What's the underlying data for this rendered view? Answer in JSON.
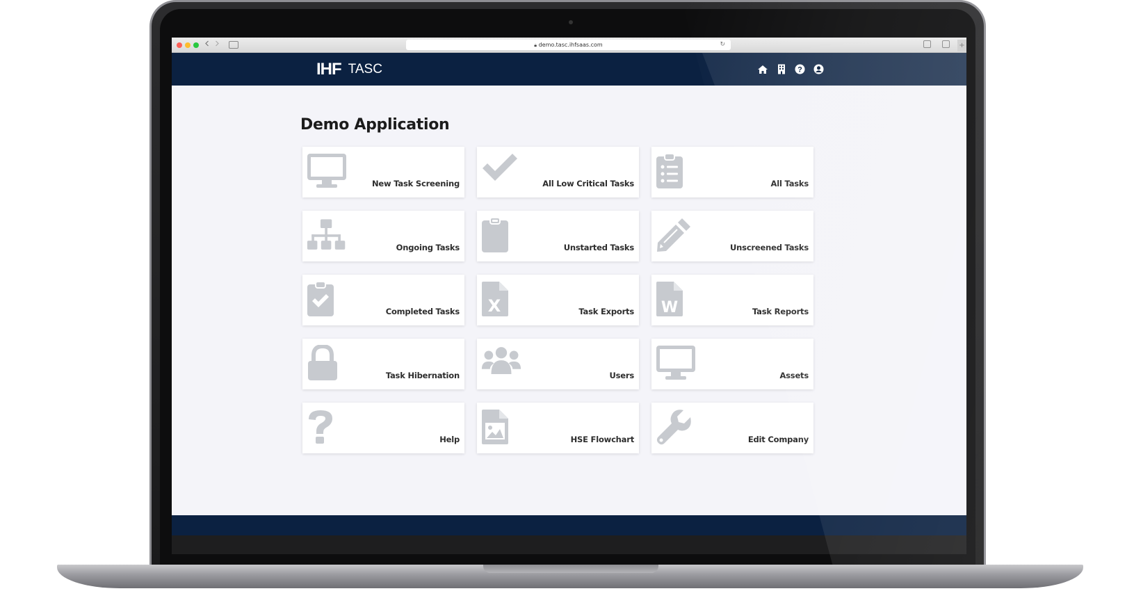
{
  "browser": {
    "url": "demo.tasc.ihfsaas.com",
    "back_icon": "chevron-left-icon",
    "forward_icon": "chevron-right-icon"
  },
  "header": {
    "logo_mark": "IHF",
    "app_name": "TASC",
    "icons": [
      "home-icon",
      "building-icon",
      "help-icon",
      "user-icon"
    ],
    "background": "#0b2141"
  },
  "main": {
    "title": "Demo Application",
    "tiles": [
      {
        "label": "New Task Screening",
        "icon": "monitor-icon"
      },
      {
        "label": "All Low Critical Tasks",
        "icon": "check-icon"
      },
      {
        "label": "All Tasks",
        "icon": "clipboard-list-icon"
      },
      {
        "label": "Ongoing Tasks",
        "icon": "sitemap-icon"
      },
      {
        "label": "Unstarted Tasks",
        "icon": "clipboard-icon"
      },
      {
        "label": "Unscreened Tasks",
        "icon": "pencil-icon"
      },
      {
        "label": "Completed Tasks",
        "icon": "clipboard-check-icon"
      },
      {
        "label": "Task Exports",
        "icon": "file-excel-icon"
      },
      {
        "label": "Task Reports",
        "icon": "file-word-icon"
      },
      {
        "label": "Task Hibernation",
        "icon": "lock-icon"
      },
      {
        "label": "Users",
        "icon": "users-icon"
      },
      {
        "label": "Assets",
        "icon": "monitor-icon"
      },
      {
        "label": "Help",
        "icon": "question-icon"
      },
      {
        "label": "HSE Flowchart",
        "icon": "file-image-icon"
      },
      {
        "label": "Edit Company",
        "icon": "wrench-icon"
      }
    ],
    "icon_color": "#c7cacf"
  }
}
